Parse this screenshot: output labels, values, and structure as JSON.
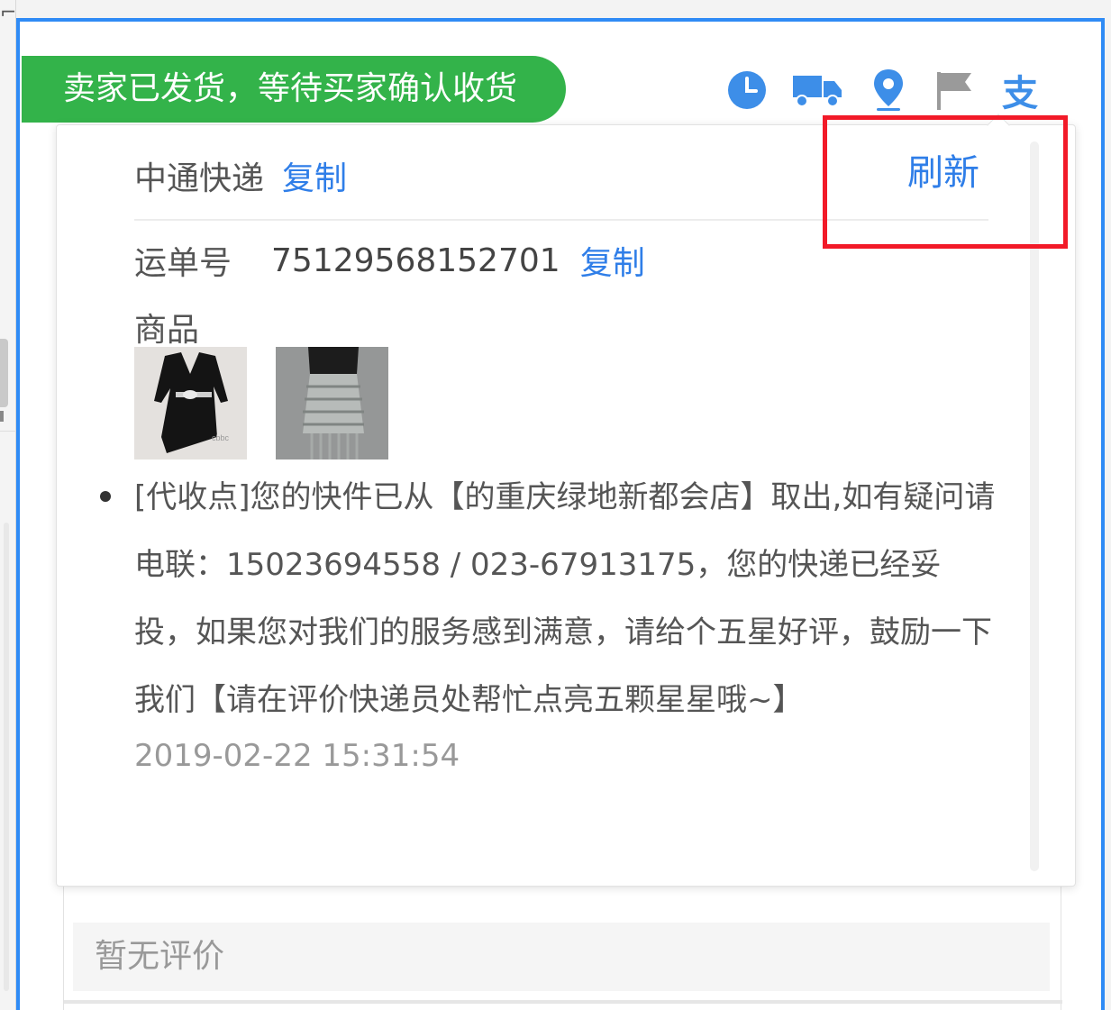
{
  "status": {
    "text": "卖家已发货，等待买家确认收货",
    "color": "#33b34a"
  },
  "icons": [
    {
      "name": "clock-icon"
    },
    {
      "name": "truck-icon"
    },
    {
      "name": "location-pin-icon"
    },
    {
      "name": "flag-icon"
    },
    {
      "name": "alipay-icon",
      "glyph": "支"
    }
  ],
  "logistics": {
    "carrier": "中通快递",
    "copy_label": "复制",
    "refresh_label": "刷新",
    "waybill_label": "运单号",
    "waybill_number": "75129568152701",
    "waybill_copy_label": "复制",
    "goods_label": "商品",
    "goods_thumbnails": [
      "black-dress-thumbnail",
      "grey-fringe-skirt-thumbnail"
    ],
    "events": [
      {
        "text": "[代收点]您的快件已从【的重庆绿地新都会店】取出,如有疑问请电联：15023694558 / 023-67913175，您的快递已经妥投，如果您对我们的服务感到满意，请给个五星好评，鼓励一下我们【请在评价快递员处帮忙点亮五颗星星哦~】",
        "time": "2019-02-22 15:31:54"
      }
    ]
  },
  "review": {
    "empty_text": "暂无评价"
  },
  "colors": {
    "accent": "#2f7ee8",
    "frame": "#2f8bf5",
    "highlight": "#f21a28"
  }
}
